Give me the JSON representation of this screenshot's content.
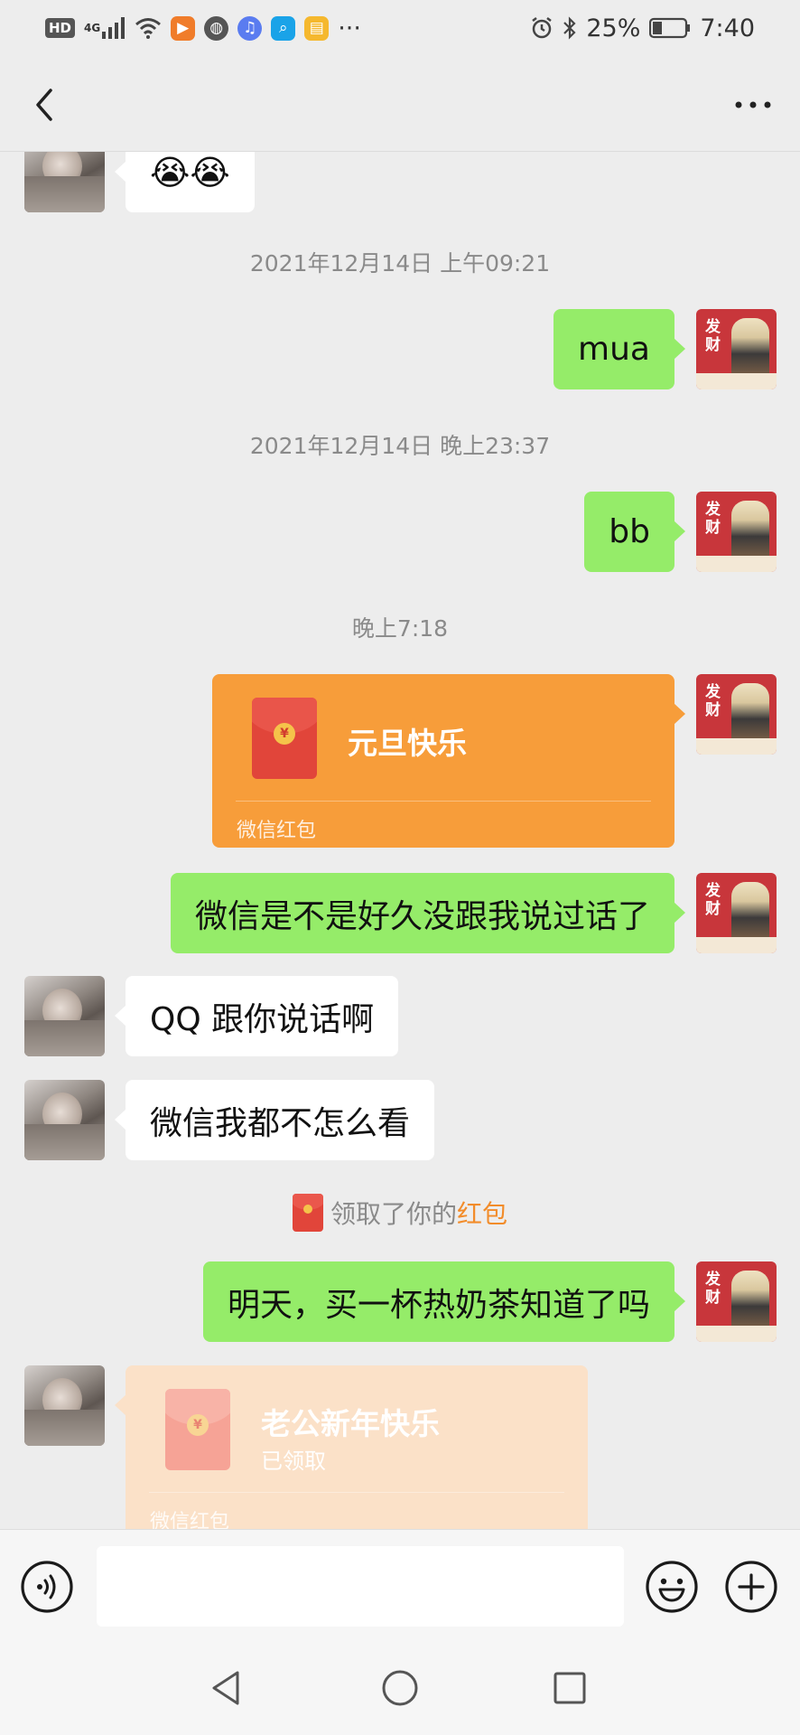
{
  "status_bar": {
    "network_badge": "HD",
    "signal_type": "4G",
    "battery_percent": "25%",
    "time": "7:40",
    "more": "···",
    "icons": [
      "hd-icon",
      "signal-icon",
      "wifi-icon",
      "video-app-icon",
      "browser-app-icon",
      "music-app-icon",
      "search-app-icon",
      "notes-app-icon",
      "alarm-icon",
      "bluetooth-icon",
      "battery-icon"
    ]
  },
  "header": {
    "back_icon": "chevron-left-icon",
    "more_icon": "more-horizontal-icon"
  },
  "messages": [
    {
      "type": "incoming",
      "text": "😭😭"
    },
    {
      "type": "timestamp",
      "text": "2021年12月14日 上午09:21"
    },
    {
      "type": "outgoing",
      "text": "mua"
    },
    {
      "type": "timestamp",
      "text": "2021年12月14日 晚上23:37"
    },
    {
      "type": "outgoing",
      "text": "bb"
    },
    {
      "type": "timestamp",
      "text": "晚上7:18"
    },
    {
      "type": "outgoing-red-packet",
      "title": "元旦快乐",
      "footer": "微信红包",
      "coin": "¥"
    },
    {
      "type": "outgoing",
      "text": "微信是不是好久没跟我说过话了"
    },
    {
      "type": "incoming",
      "text": "QQ 跟你说话啊"
    },
    {
      "type": "incoming",
      "text": "微信我都不怎么看"
    },
    {
      "type": "system",
      "prefix": "领取了你的",
      "highlight": "红包"
    },
    {
      "type": "outgoing",
      "text": "明天，买一杯热奶茶知道了吗"
    },
    {
      "type": "incoming-red-packet",
      "title": "老公新年快乐",
      "status": "已领取",
      "footer": "微信红包",
      "coin": "¥"
    }
  ],
  "input_bar": {
    "voice_icon": "voice-icon",
    "emoji_icon": "emoji-icon",
    "plus_icon": "plus-circle-icon",
    "placeholder": ""
  },
  "nav_bar": {
    "icons": [
      "nav-back-icon",
      "nav-home-icon",
      "nav-recents-icon"
    ]
  },
  "colors": {
    "background": "#ededed",
    "outgoing_bubble": "#95ec69",
    "incoming_bubble": "#ffffff",
    "red_packet": "#f79d3a",
    "red_packet_received": "#fbe1c8",
    "highlight": "#f28c2a"
  }
}
